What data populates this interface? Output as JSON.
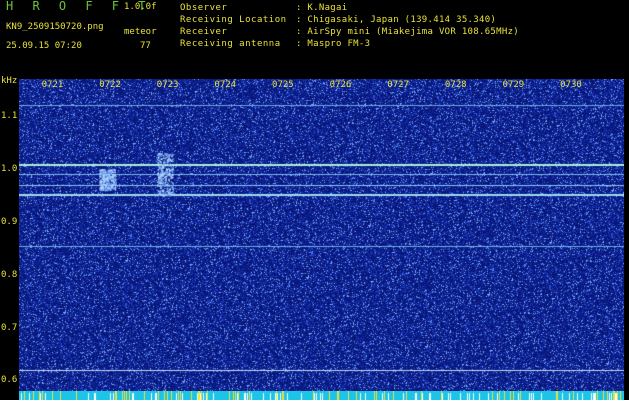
{
  "header": {
    "app_title": "H R O F F T",
    "version": "1.0.0f",
    "filename": "KN9_2509150720.png",
    "meteor_label": "meteor",
    "datetime": "25.09.15 07:20",
    "meteor_count": "77",
    "info": [
      {
        "label": "Observer",
        "value": ": K.Nagai"
      },
      {
        "label": "Receiving Location",
        "value": ": Chigasaki, Japan (139.414 35.340)"
      },
      {
        "label": "Receiver",
        "value": ": AirSpy mini (Miakejima VOR 108.65MHz)"
      },
      {
        "label": "Receiving antenna",
        "value": ": Maspro FM-3"
      }
    ]
  },
  "colors": {
    "background": "#000000",
    "text": "#e8e23a",
    "title": "#6cc43a",
    "noise_bg": "#0a1f8c",
    "signal": "#9ee8d0",
    "baseline": "#1cc4e8"
  },
  "chart_data": {
    "type": "heatmap",
    "y_unit": "kHz",
    "y_ticks": [
      "1.1",
      "1.0",
      "0.9",
      "0.8",
      "0.7",
      "0.6"
    ],
    "y_tick_values": [
      1.1,
      1.0,
      0.9,
      0.8,
      0.7,
      0.6
    ],
    "ylim": [
      0.58,
      1.17
    ],
    "x_ticks": [
      "0721",
      "0722",
      "0723",
      "0724",
      "0725",
      "0726",
      "0727",
      "0728",
      "0729",
      "0730"
    ],
    "xlim_minutes": [
      20.4,
      30.9
    ],
    "horizontal_lines_khz": [
      1.12,
      1.01,
      0.99,
      0.952,
      0.97,
      0.855,
      0.62
    ],
    "meteor_bursts": [
      {
        "time": "0722",
        "freq_range": [
          0.96,
          1.0
        ]
      },
      {
        "time": "0723",
        "freq_range": [
          0.95,
          1.03
        ]
      }
    ],
    "grid": false
  }
}
